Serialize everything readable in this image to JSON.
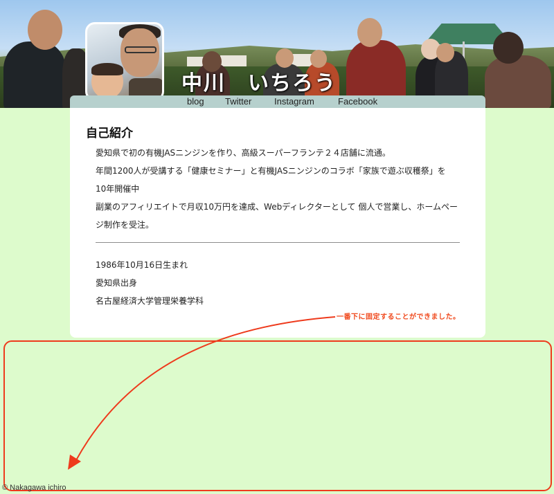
{
  "header": {
    "name": "中川　いちろう"
  },
  "nav": {
    "items": [
      {
        "label": "blog"
      },
      {
        "label": "Twitter"
      },
      {
        "label": "Instagram"
      },
      {
        "label": "Facebook"
      }
    ]
  },
  "intro": {
    "title": "自己紹介",
    "lines": [
      "愛知県で初の有機JASニンジンを作り、高級スーパーフランテ２４店舗に流通。",
      "年間1200人が受講する「健康セミナー」と有機JASニンジンのコラボ「家族で遊ぶ収穫祭」を",
      "10年開催中",
      "副業のアフィリエイトで月収10万円を達成、Webディレクターとして 個人で営業し、ホームペー",
      "ジ制作を受注。"
    ]
  },
  "profile": {
    "lines": [
      "1986年10月16日生まれ",
      "愛知県出身",
      "名古屋経済大学管理栄養学科"
    ]
  },
  "annotation": {
    "text": "一番下に固定することができました。",
    "color": "#f04a1e"
  },
  "footer": {
    "text": "© Nakagawa ichiro"
  },
  "colors": {
    "background": "#ddfbcc",
    "nav": "#b6d0cd",
    "card": "#ffffff",
    "highlight": "#ee3a1c"
  }
}
